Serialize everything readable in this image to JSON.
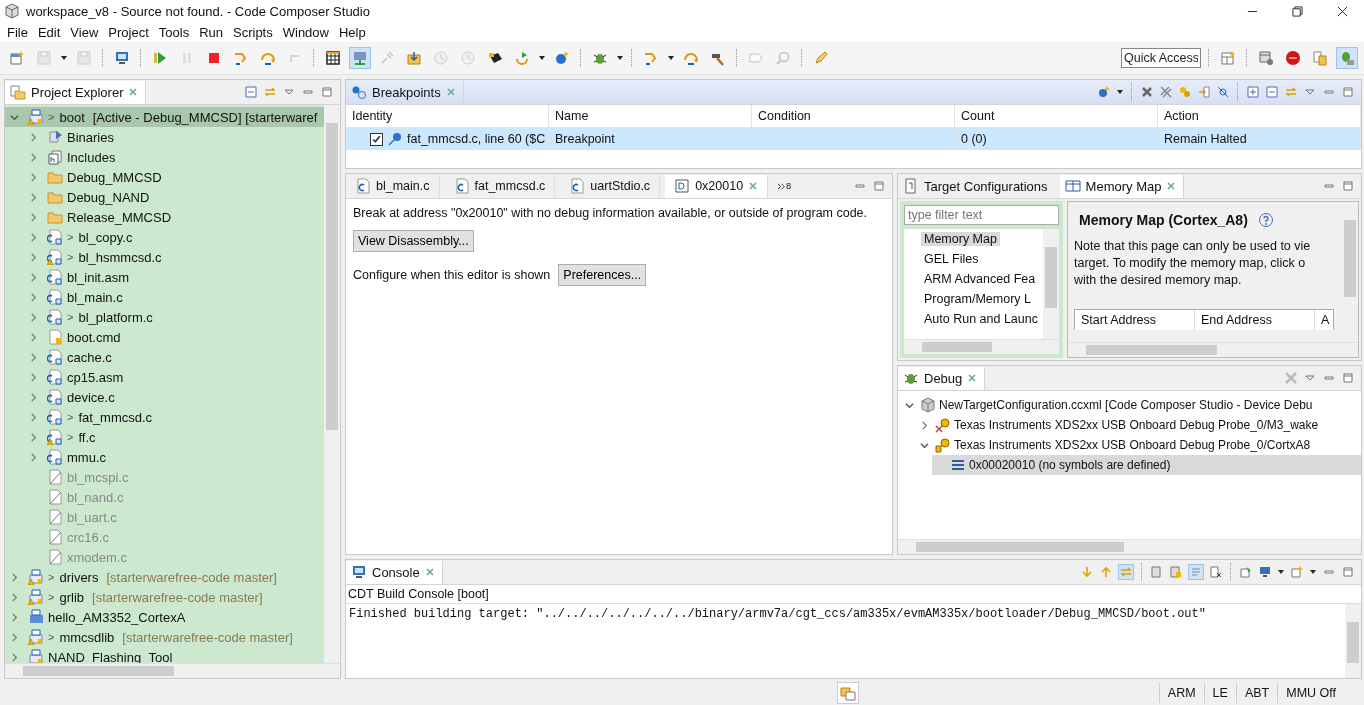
{
  "window": {
    "title": "workspace_v8 - Source not found. - Code Composer Studio"
  },
  "menu": [
    "File",
    "Edit",
    "View",
    "Project",
    "Tools",
    "Run",
    "Scripts",
    "Window",
    "Help"
  ],
  "quick_access": {
    "placeholder": "Quick Access"
  },
  "explorer": {
    "title": "Project Explorer",
    "items": [
      {
        "label": "boot",
        "decoration": ">",
        "detail": "[Active - Debug_MMCSD] [starterwaref",
        "kind": "project",
        "warning": true,
        "expanded": true,
        "selected": true,
        "excluded": false,
        "children": [
          {
            "label": "Binaries",
            "kind": "binaries",
            "warning": false,
            "expanded": false,
            "selected": false,
            "excluded": false
          },
          {
            "label": "Includes",
            "kind": "includes",
            "warning": false,
            "expanded": false,
            "selected": false,
            "excluded": false
          },
          {
            "label": "Debug_MMCSD",
            "kind": "folder",
            "warning": false,
            "expanded": false,
            "selected": false,
            "excluded": false
          },
          {
            "label": "Debug_NAND",
            "kind": "folder",
            "warning": false,
            "expanded": false,
            "selected": false,
            "excluded": false
          },
          {
            "label": "Release_MMCSD",
            "kind": "folder",
            "warning": false,
            "expanded": false,
            "selected": false,
            "excluded": false
          },
          {
            "label": "bl_copy.c",
            "decoration": ">",
            "kind": "source",
            "warning": false,
            "expanded": false,
            "selected": false,
            "excluded": false
          },
          {
            "label": "bl_hsmmcsd.c",
            "decoration": ">",
            "kind": "source",
            "warning": true,
            "expanded": false,
            "selected": false,
            "excluded": false
          },
          {
            "label": "bl_init.asm",
            "kind": "source",
            "warning": false,
            "expanded": false,
            "selected": false,
            "excluded": false
          },
          {
            "label": "bl_main.c",
            "kind": "source",
            "warning": false,
            "expanded": false,
            "selected": false,
            "excluded": false
          },
          {
            "label": "bl_platform.c",
            "decoration": ">",
            "kind": "source",
            "warning": false,
            "expanded": false,
            "selected": false,
            "excluded": false
          },
          {
            "label": "boot.cmd",
            "kind": "cmd",
            "warning": false,
            "expanded": false,
            "selected": false,
            "excluded": false
          },
          {
            "label": "cache.c",
            "kind": "source",
            "warning": false,
            "expanded": false,
            "selected": false,
            "excluded": false
          },
          {
            "label": "cp15.asm",
            "kind": "source",
            "warning": false,
            "expanded": false,
            "selected": false,
            "excluded": false
          },
          {
            "label": "device.c",
            "kind": "source",
            "warning": false,
            "expanded": false,
            "selected": false,
            "excluded": false
          },
          {
            "label": "fat_mmcsd.c",
            "decoration": ">",
            "kind": "source",
            "warning": false,
            "expanded": false,
            "selected": false,
            "excluded": false
          },
          {
            "label": "ff.c",
            "decoration": ">",
            "kind": "source",
            "warning": true,
            "expanded": false,
            "selected": false,
            "excluded": false
          },
          {
            "label": "mmu.c",
            "kind": "source",
            "warning": false,
            "expanded": false,
            "selected": false,
            "excluded": false
          },
          {
            "label": "bl_mcspi.c",
            "kind": "excluded",
            "warning": false,
            "selected": false,
            "excluded": true
          },
          {
            "label": "bl_nand.c",
            "kind": "excluded",
            "warning": false,
            "selected": false,
            "excluded": true
          },
          {
            "label": "bl_uart.c",
            "kind": "excluded",
            "warning": false,
            "selected": false,
            "excluded": true
          },
          {
            "label": "crc16.c",
            "kind": "excluded",
            "warning": false,
            "selected": false,
            "excluded": true
          },
          {
            "label": "xmodem.c",
            "kind": "excluded",
            "warning": false,
            "selected": false,
            "excluded": true
          }
        ]
      },
      {
        "label": "drivers",
        "decoration": ">",
        "detail": "[starterwarefree-code master]",
        "kind": "project",
        "warning": true,
        "expanded": false,
        "selected": false,
        "excluded": false
      },
      {
        "label": "grlib",
        "decoration": ">",
        "detail": "[starterwarefree-code master]",
        "kind": "project",
        "warning": true,
        "expanded": false,
        "selected": false,
        "excluded": false
      },
      {
        "label": "hello_AM3352_CortexA",
        "kind": "rtsc",
        "warning": false,
        "expanded": false,
        "selected": false,
        "excluded": false
      },
      {
        "label": "mmcsdlib",
        "decoration": ">",
        "detail": "[starterwarefree-code master]",
        "kind": "project",
        "warning": true,
        "expanded": false,
        "selected": false,
        "excluded": false
      },
      {
        "label": "NAND_Flashing_Tool",
        "kind": "project",
        "warning": false,
        "expanded": false,
        "selected": false,
        "excluded": false
      }
    ]
  },
  "breakpoints": {
    "title": "Breakpoints",
    "columns": [
      "Identity",
      "Name",
      "Condition",
      "Count",
      "Action"
    ],
    "rows": [
      {
        "checked": true,
        "selected": true,
        "identity": "fat_mmcsd.c, line 60 ($C",
        "name": "Breakpoint",
        "count": "0 (0)",
        "action": "Remain Halted"
      }
    ]
  },
  "editor": {
    "tabs": [
      {
        "label": "bl_main.c",
        "kind": "source",
        "selected": false
      },
      {
        "label": "fat_mmcsd.c",
        "kind": "source",
        "selected": false
      },
      {
        "label": "uartStdio.c",
        "kind": "source",
        "selected": false
      },
      {
        "label": "0x20010",
        "kind": "address",
        "selected": true
      }
    ],
    "overflow_count": "8",
    "message": "Break at address \"0x20010\" with no debug information available, or outside of program code.",
    "view_button": "View Disassembly...",
    "configure_label": "Configure when this editor is shown",
    "preferences_button": "Preferences..."
  },
  "target_panel": {
    "tabs": [
      {
        "label": "Target Configurations",
        "selected": false
      },
      {
        "label": "Memory Map",
        "selected": true
      }
    ],
    "filter": {
      "placeholder": "type filter text"
    },
    "pages": [
      {
        "label": "Memory Map",
        "selected": true
      },
      {
        "label": "GEL Files",
        "selected": false
      },
      {
        "label": "ARM Advanced Fea",
        "selected": false
      },
      {
        "label": "Program/Memory L",
        "selected": false
      },
      {
        "label": "Auto Run and Launc",
        "selected": false
      }
    ],
    "heading": "Memory Map (Cortex_A8)",
    "note_lines": [
      "Note that this page can only be used to vie",
      "target.  To modify the memory map, click o",
      "with the desired memory map."
    ],
    "columns": [
      "Start Address",
      "End Address",
      "A"
    ]
  },
  "debug": {
    "title": "Debug",
    "items": [
      {
        "label": "NewTargetConfiguration.ccxml [Code Composer Studio - Device Debu",
        "kind": "launch",
        "expanded": true,
        "selected": false,
        "children": [
          {
            "label": "Texas Instruments XDS2xx USB Onboard Debug Probe_0/M3_wake",
            "kind": "core_disconnected",
            "expanded": false,
            "selected": false
          },
          {
            "label": "Texas Instruments XDS2xx USB Onboard Debug Probe_0/CortxA8",
            "kind": "core",
            "expanded": true,
            "selected": false,
            "children": [
              {
                "label": "0x00020010  (no symbols are defined)",
                "kind": "frame",
                "selected": true
              }
            ]
          }
        ]
      }
    ]
  },
  "console": {
    "title": "Console",
    "subtitle": "CDT Build Console [boot]",
    "lines": [
      "Finished building target: \"../../../../../../../binary/armv7a/cgt_ccs/am335x/evmAM335x/bootloader/Debug_MMCSD/boot.out\""
    ]
  },
  "status_bar": [
    "ARM",
    "LE",
    "ABT",
    "MMU Off"
  ]
}
